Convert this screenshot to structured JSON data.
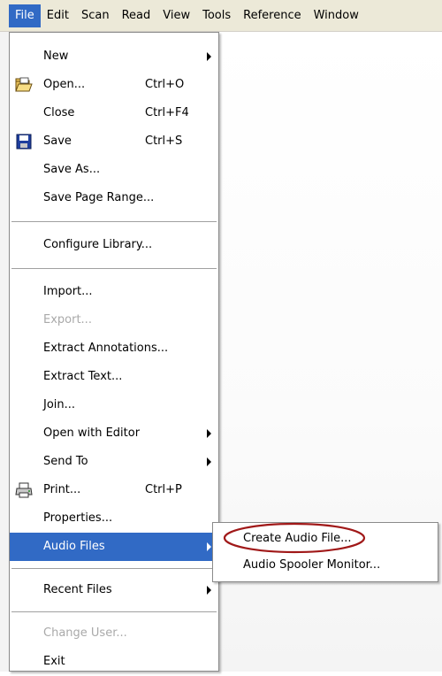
{
  "menubar": {
    "items": [
      "File",
      "Edit",
      "Scan",
      "Read",
      "View",
      "Tools",
      "Reference",
      "Window"
    ]
  },
  "file_menu": {
    "items": [
      {
        "label": "New",
        "accel": "",
        "submenu": true,
        "icon": "",
        "disabled": false
      },
      {
        "label": "Open...",
        "accel": "Ctrl+O",
        "submenu": false,
        "icon": "folder-open-icon",
        "disabled": false
      },
      {
        "label": "Close",
        "accel": "Ctrl+F4",
        "submenu": false,
        "icon": "",
        "disabled": false
      },
      {
        "label": "Save",
        "accel": "Ctrl+S",
        "submenu": false,
        "icon": "floppy-disk-icon",
        "disabled": false
      },
      {
        "label": "Save As...",
        "accel": "",
        "submenu": false,
        "icon": "",
        "disabled": false
      },
      {
        "label": "Save Page Range...",
        "accel": "",
        "submenu": false,
        "icon": "",
        "disabled": false
      },
      {
        "label": "Configure Library...",
        "accel": "",
        "submenu": false,
        "icon": "",
        "disabled": false
      },
      {
        "label": "Import...",
        "accel": "",
        "submenu": false,
        "icon": "",
        "disabled": false
      },
      {
        "label": "Export...",
        "accel": "",
        "submenu": false,
        "icon": "",
        "disabled": true
      },
      {
        "label": "Extract Annotations...",
        "accel": "",
        "submenu": false,
        "icon": "",
        "disabled": false
      },
      {
        "label": "Extract Text...",
        "accel": "",
        "submenu": false,
        "icon": "",
        "disabled": false
      },
      {
        "label": "Join...",
        "accel": "",
        "submenu": false,
        "icon": "",
        "disabled": false
      },
      {
        "label": "Open with Editor",
        "accel": "",
        "submenu": true,
        "icon": "",
        "disabled": false
      },
      {
        "label": "Send To",
        "accel": "",
        "submenu": true,
        "icon": "",
        "disabled": false
      },
      {
        "label": "Print...",
        "accel": "Ctrl+P",
        "submenu": false,
        "icon": "printer-icon",
        "disabled": false
      },
      {
        "label": "Properties...",
        "accel": "",
        "submenu": false,
        "icon": "",
        "disabled": false
      },
      {
        "label": "Audio Files",
        "accel": "",
        "submenu": true,
        "icon": "",
        "disabled": false,
        "highlighted": true
      },
      {
        "label": "Recent Files",
        "accel": "",
        "submenu": true,
        "icon": "",
        "disabled": false
      },
      {
        "label": "Change User...",
        "accel": "",
        "submenu": false,
        "icon": "",
        "disabled": true
      },
      {
        "label": "Exit",
        "accel": "",
        "submenu": false,
        "icon": "",
        "disabled": false
      }
    ]
  },
  "audio_submenu": {
    "items": [
      {
        "label": "Create Audio File..."
      },
      {
        "label": "Audio Spooler Monitor..."
      }
    ]
  },
  "colors": {
    "menu_highlight": "#316ac5",
    "annotation_circle": "#a01818",
    "disabled_text": "#a9a9a9"
  }
}
